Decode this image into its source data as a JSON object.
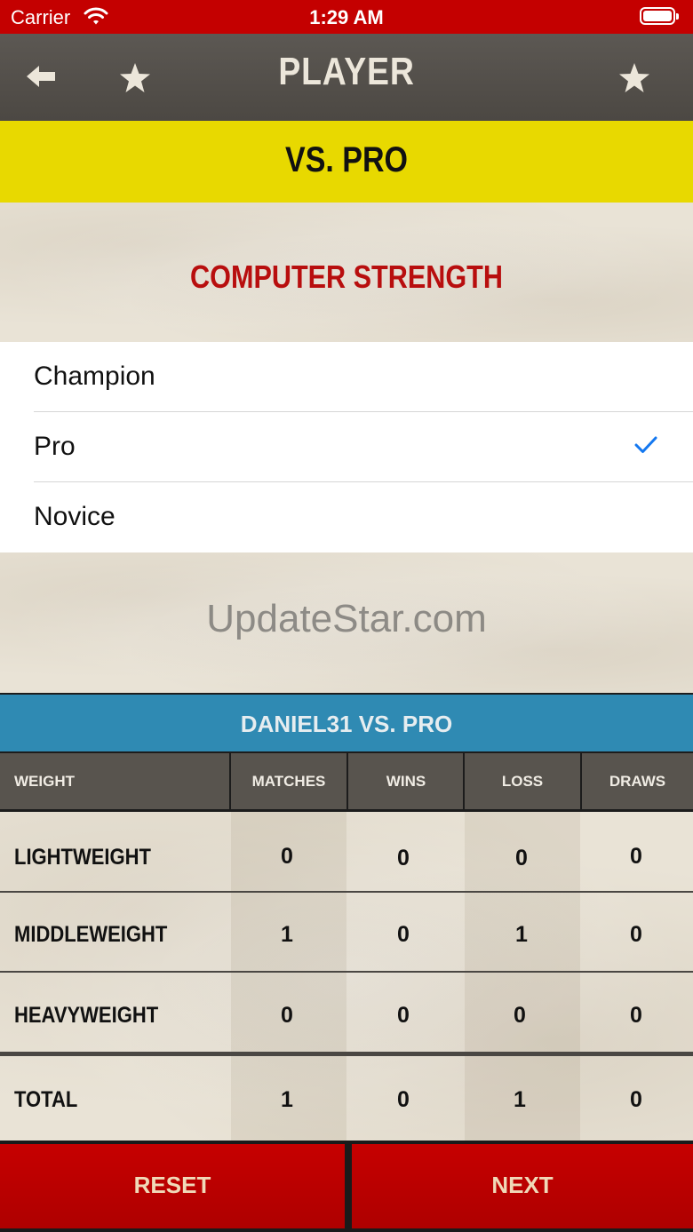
{
  "status_bar": {
    "carrier": "Carrier",
    "time": "1:29 AM",
    "icons": [
      "wifi-icon",
      "battery-icon"
    ],
    "background": "#c40000"
  },
  "nav": {
    "title": "PLAYER",
    "icons": [
      "back-arrow-icon",
      "star-icon",
      "star-icon"
    ]
  },
  "mode": {
    "label": "VS. PRO",
    "color": "#e8d900"
  },
  "section": {
    "title": "COMPUTER STRENGTH",
    "color": "#b80e0e"
  },
  "options": [
    {
      "label": "Champion",
      "selected": false
    },
    {
      "label": "Pro",
      "selected": true
    },
    {
      "label": "Novice",
      "selected": false
    }
  ],
  "watermark": "UpdateStar.com",
  "stats": {
    "title": "DANIEL31 VS. PRO",
    "title_color": "#2f8ab3",
    "columns": [
      "WEIGHT",
      "MATCHES",
      "WINS",
      "LOSS",
      "DRAWS"
    ],
    "rows": [
      {
        "name": "LIGHTWEIGHT",
        "matches": "0",
        "wins": "0",
        "loss": "0",
        "draws": "0"
      },
      {
        "name": "MIDDLEWEIGHT",
        "matches": "1",
        "wins": "0",
        "loss": "1",
        "draws": "0"
      },
      {
        "name": "HEAVYWEIGHT",
        "matches": "0",
        "wins": "0",
        "loss": "0",
        "draws": "0"
      }
    ],
    "total": {
      "name": "TOTAL",
      "matches": "1",
      "wins": "0",
      "loss": "1",
      "draws": "0"
    }
  },
  "buttons": {
    "reset": "RESET",
    "next": "NEXT",
    "color": "#c60000"
  }
}
